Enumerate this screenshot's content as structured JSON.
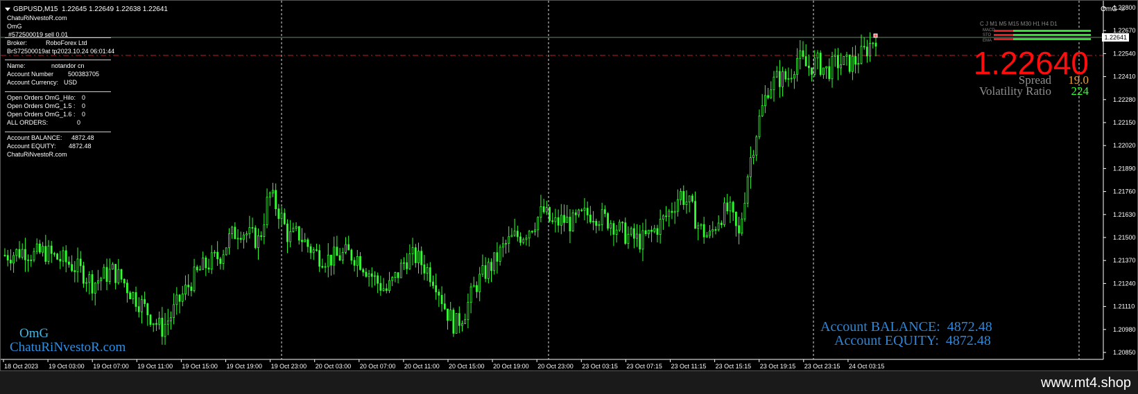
{
  "window": {
    "symbol": "GBPUSD,M15",
    "ohlc": "1.22645 1.22649 1.22638 1.22641",
    "indicator_name": "OmG",
    "corner_label": "OmG"
  },
  "info_panel": {
    "site": "ChatuRiNvestoR.com",
    "indicator": "OmG",
    "order_line": "#572500019 sell 0.01",
    "broker_label": "Broker:",
    "broker_value": "RoboForex Ltd",
    "time_line": "BrS72500019at tp2023.10.24 06:01:44",
    "name_label": "Name:",
    "name_value": "notandor cn",
    "account_number_label": "Account Number",
    "account_number_value": "500383705",
    "account_currency_label": "Account Currency:",
    "account_currency_value": "USD",
    "open_orders": [
      {
        "label": "Open Orders OmG_Hilo:",
        "value": "0"
      },
      {
        "label": "Open Orders OmG_1.5 :",
        "value": "0"
      },
      {
        "label": "Open Orders OmG_1.6 :",
        "value": "0"
      },
      {
        "label": "ALL ORDERS:",
        "value": "0"
      }
    ],
    "balance_label": "Account BALANCE:",
    "balance_value": "4872.48",
    "equity_label": "Account EQUITY:",
    "equity_value": "4872.48",
    "site_footer": "ChatuRiNvestoR.com"
  },
  "watermark": {
    "omg": "OmG",
    "site": "ChatuRiNvestoR.com"
  },
  "price_display": {
    "price": "1.22640",
    "spread_label": "Spread",
    "spread_value": "19.0",
    "volatility_label": "Volatility Ratio",
    "volatility_value": "224"
  },
  "timeframes": {
    "header": "C J    M1   M5  M15 M30  H1    H4   D1",
    "rows": [
      "MACD",
      "STO",
      "EMA"
    ]
  },
  "bottom_account": {
    "balance_label": "Account BALANCE:",
    "balance_value": "4872.48",
    "equity_label": "Account EQUITY:",
    "equity_value": "4872.48"
  },
  "footer": {
    "url": "www.mt4.shop"
  },
  "colors": {
    "candle": "#33ff33",
    "big_price": "#ff0d0d",
    "spread_value": "#e8a040",
    "volatility_value": "#33ff33",
    "account_text": "#2e86d8",
    "sell_line": "#c02020"
  },
  "chart_data": {
    "type": "candlestick",
    "price_axis": [
      "1.22800",
      "1.22670",
      "1.22540",
      "1.22410",
      "1.22280",
      "1.22150",
      "1.22020",
      "1.21890",
      "1.21760",
      "1.21630",
      "1.21500",
      "1.21370",
      "1.21240",
      "1.21110",
      "1.20980",
      "1.20850"
    ],
    "current_price": "1.22641",
    "time_axis": [
      "18 Oct 2023",
      "19 Oct 03:00",
      "19 Oct 07:00",
      "19 Oct 11:00",
      "19 Oct 15:00",
      "19 Oct 19:00",
      "19 Oct 23:00",
      "20 Oct 03:00",
      "20 Oct 07:00",
      "20 Oct 11:00",
      "20 Oct 15:00",
      "20 Oct 19:00",
      "20 Oct 23:00",
      "23 Oct 03:15",
      "23 Oct 07:15",
      "23 Oct 11:15",
      "23 Oct 15:15",
      "23 Oct 19:15",
      "23 Oct 23:15",
      "24 Oct 03:15"
    ],
    "close_path": [
      1.214,
      1.2141,
      1.2143,
      1.214,
      1.2142,
      1.2139,
      1.2137,
      1.2134,
      1.213,
      1.2124,
      1.2128,
      1.2131,
      1.2126,
      1.2118,
      1.2112,
      1.2105,
      1.2098,
      1.2106,
      1.2116,
      1.2125,
      1.2132,
      1.2136,
      1.214,
      1.215,
      1.2155,
      1.2151,
      1.2148,
      1.2175,
      1.2165,
      1.215,
      1.2152,
      1.2145,
      1.214,
      1.2138,
      1.2139,
      1.2141,
      1.2139,
      1.2132,
      1.2125,
      1.212,
      1.2128,
      1.2138,
      1.2139,
      1.2133,
      1.2126,
      1.211,
      1.21,
      1.2108,
      1.2122,
      1.213,
      1.2136,
      1.2145,
      1.215,
      1.2152,
      1.2158,
      1.2165,
      1.2157,
      1.216,
      1.2158,
      1.2162,
      1.2164,
      1.2161,
      1.2159,
      1.2153,
      1.215,
      1.2148,
      1.2152,
      1.2158,
      1.2165,
      1.2175,
      1.2168,
      1.2155,
      1.215,
      1.2162,
      1.2166,
      1.215,
      1.219,
      1.2215,
      1.2235,
      1.224,
      1.224,
      1.2252,
      1.2246,
      1.2249,
      1.2244,
      1.2249,
      1.2248,
      1.225,
      1.2256,
      1.2264
    ]
  }
}
